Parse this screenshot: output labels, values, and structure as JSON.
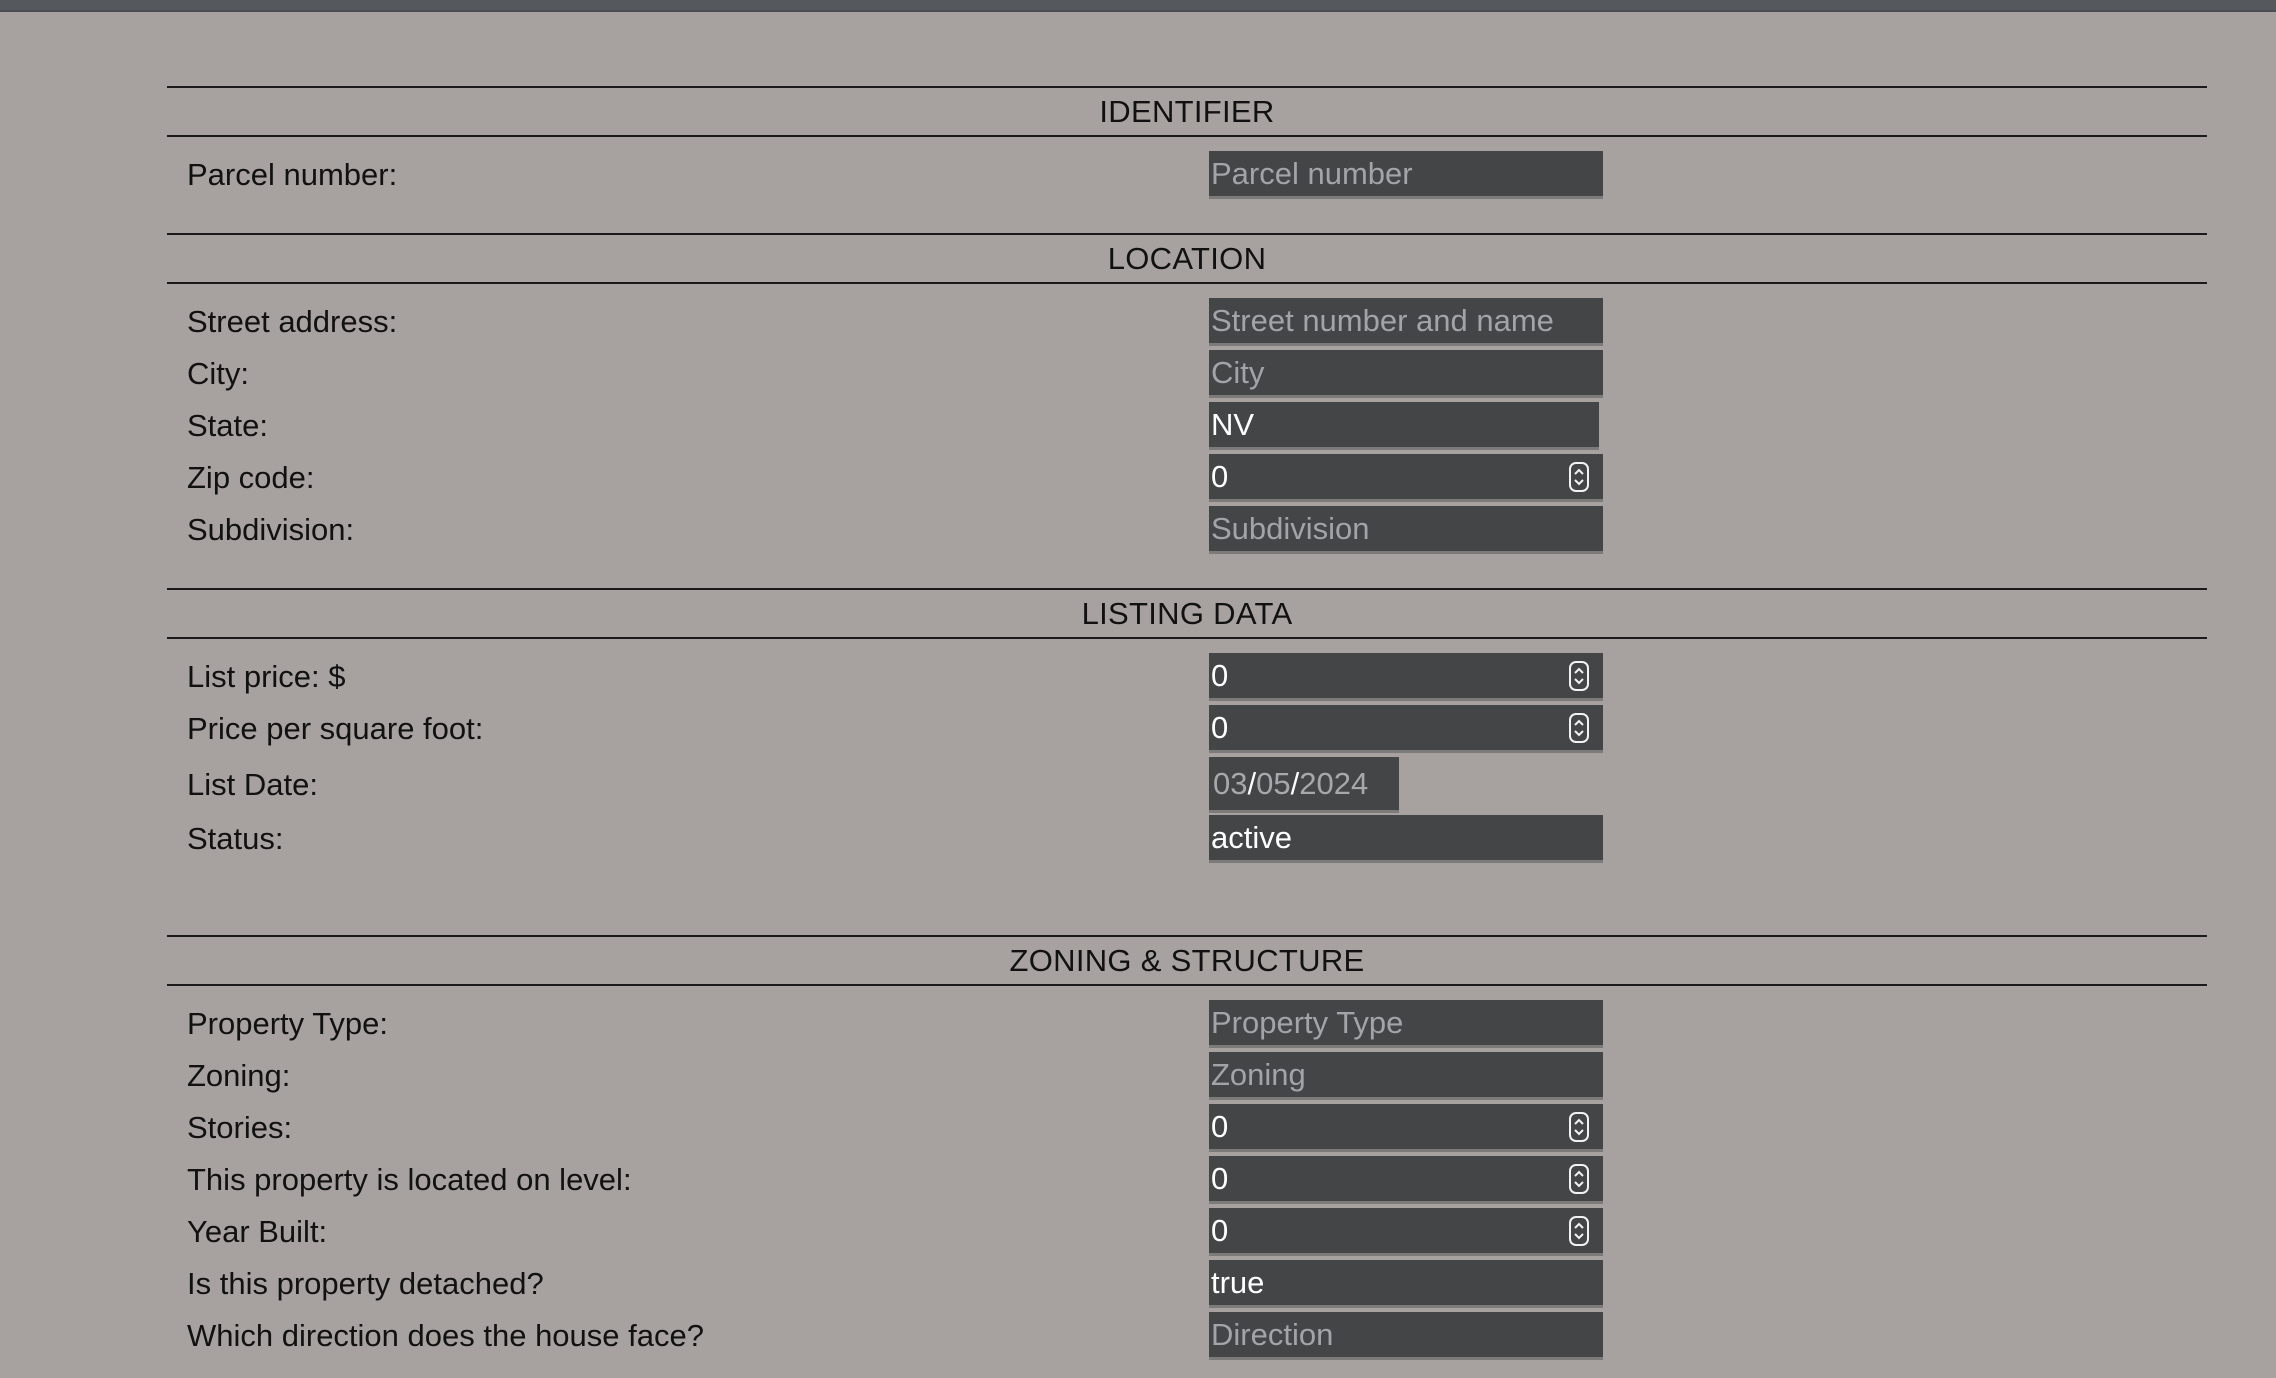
{
  "sections": {
    "identifier": {
      "title": "IDENTIFIER",
      "parcel_label": "Parcel number:",
      "parcel_placeholder": "Parcel number"
    },
    "location": {
      "title": "LOCATION",
      "street_label": "Street address:",
      "street_placeholder": "Street number and name",
      "city_label": "City:",
      "city_placeholder": "City",
      "state_label": "State:",
      "state_value": "NV",
      "zip_label": "Zip code:",
      "zip_value": "0",
      "subdivision_label": "Subdivision:",
      "subdivision_placeholder": "Subdivision"
    },
    "listing": {
      "title": "LISTING DATA",
      "price_label": "List price: $",
      "price_value": "0",
      "ppsf_label": "Price per square foot:",
      "ppsf_value": "0",
      "date_label": "List Date:",
      "date_month": "03",
      "date_day": "05",
      "date_year": "2024",
      "date_sep": "/",
      "status_label": "Status:",
      "status_value": "active"
    },
    "zoning": {
      "title": "ZONING & STRUCTURE",
      "ptype_label": "Property Type:",
      "ptype_placeholder": "Property Type",
      "zoning_label": "Zoning:",
      "zoning_placeholder": "Zoning",
      "stories_label": "Stories:",
      "stories_value": "0",
      "level_label": "This property is located on level:",
      "level_value": "0",
      "year_label": "Year Built:",
      "year_value": "0",
      "detached_label": "Is this property detached?",
      "detached_value": "true",
      "direction_label": "Which direction does the house face?",
      "direction_placeholder": "Direction"
    }
  },
  "colors": {
    "background": "#a7a29f",
    "field": "#434547",
    "field_text": "#ffffff",
    "placeholder": "#a3a3a8"
  }
}
